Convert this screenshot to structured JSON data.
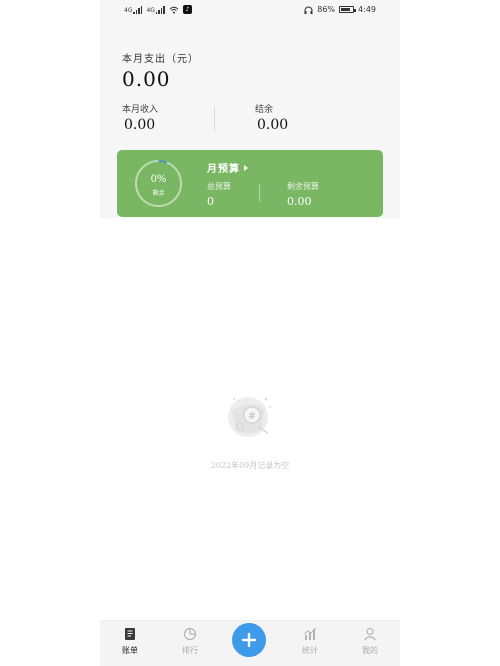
{
  "status_bar": {
    "signal_tag_1": "4G",
    "signal_tag_2": "4G",
    "battery_percent": "86%",
    "time": "4:49",
    "battery_level": 0.86
  },
  "summary": {
    "expense_label": "本月支出（元）",
    "expense_value": "0.00",
    "income_label": "本月收入",
    "income_value": "0.00",
    "balance_label": "结余",
    "balance_value": "0.00"
  },
  "budget": {
    "title": "月预算",
    "ring_percent": "0%",
    "ring_sub": "剩余",
    "total_label": "总预算",
    "total_value": "0",
    "remain_label": "剩余预算",
    "remain_value": "0.00",
    "card_color": "#79b763"
  },
  "empty_state": {
    "icon": "hashtag-bucket-icon",
    "text": "2022年09月记录为空"
  },
  "bottom_nav": {
    "items": [
      {
        "label": "账单",
        "icon": "ledger-icon",
        "active": true
      },
      {
        "label": "排行",
        "icon": "pie-chart-icon",
        "active": false
      },
      {
        "label": "统计",
        "icon": "bar-chart-icon",
        "active": false
      },
      {
        "label": "我的",
        "icon": "person-icon",
        "active": false
      }
    ],
    "add_icon": "plus-icon",
    "accent": "#3d9be9"
  }
}
